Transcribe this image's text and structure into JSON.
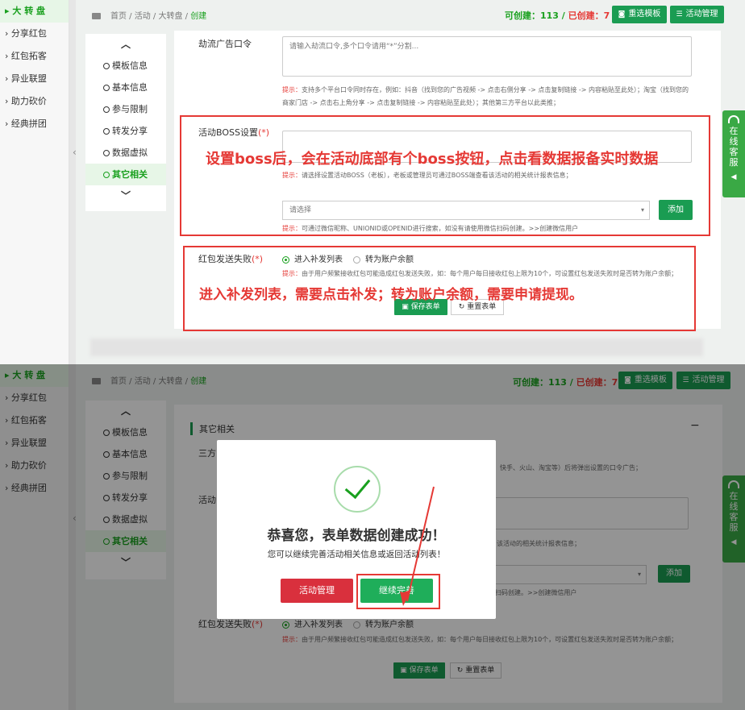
{
  "sidebar": {
    "items": [
      {
        "label": "大 转 盘"
      },
      {
        "label": "分享红包"
      },
      {
        "label": "红包拓客"
      },
      {
        "label": "异业联盟"
      },
      {
        "label": "助力砍价"
      },
      {
        "label": "经典拼团"
      }
    ],
    "active_index": 0
  },
  "breadcrumb": {
    "home": "首页",
    "sep": " / ",
    "activity": "活动",
    "wheel": "大转盘",
    "current": "创建"
  },
  "counts": {
    "can_create_label": "可创建：",
    "can_create": "113",
    "divider": " / ",
    "created_label": "已创建：",
    "created": "7"
  },
  "toolbar": {
    "reselect_template": "重选模板",
    "activity_manage": "活动管理"
  },
  "steps": [
    {
      "label": "模板信息"
    },
    {
      "label": "基本信息"
    },
    {
      "label": "参与限制"
    },
    {
      "label": "转发分享"
    },
    {
      "label": "数据虚拟"
    },
    {
      "label": "其它相关"
    }
  ],
  "form": {
    "ad_code_label": "劫流广告口令",
    "ad_code_placeholder": "请输入劫流口令,多个口令请用“*”分割...",
    "ad_code_hint_prefix": "提示：",
    "ad_code_hint": "支持多个平台口令同时存在，例如：抖音（找到您的广告视频 -> 点击右侧分享 -> 点击复制链接 -> 内容粘贴至此处）；淘宝（找到您的商家门店 -> 点击右上角分享 -> 点击复制链接 -> 内容粘贴至此处）；其他第三方平台以此类推；",
    "boss_label": "活动BOSS设置",
    "required_mark": "(*)",
    "boss_hint_prefix": "提示：",
    "boss_hint": "请选择设置活动BOSS（老板），老板或管理员可通过BOSS端查看该活动的相关统计报表信息；",
    "boss_select_placeholder": "请选择",
    "add_button": "添加",
    "search_hint_prefix": "提示：",
    "search_hint": "可通过微信昵称、UNIONID或OPENID进行搜索，如没有请使用微信扫码创建。>>创建微信用户",
    "fail_label": "红包发送失败",
    "radio_reissue": "进入补发列表",
    "radio_balance": "转为账户余额",
    "fail_hint_prefix": "提示：",
    "fail_hint": "由于用户频繁接收红包可能造成红包发送失败，如：每个用户每日接收红包上限为10个，可设置红包发送失败时是否转为账户余额；",
    "save_button": "保存表单",
    "reset_button": "重置表单"
  },
  "annotations": {
    "boss": "设置boss后，会在活动底部有个boss按钮，点击看数据报备实时数据",
    "fail": "进入补发列表，需要点击补发；转为账户余额，需要申请提现。"
  },
  "customer_service": {
    "label": "在线客服"
  },
  "panel2": {
    "section_title": "其它相关",
    "third_party_label": "三方",
    "third_party_hint_tail": "快手、火山、淘宝等）后将弹出设置的口令广告；",
    "activity_label": "活动",
    "boss_hint_tail": "该活动的相关统计报表信息；",
    "search_hint_tail": "扫码创建。>>创建微信用户"
  },
  "modal": {
    "title": "恭喜您，表单数据创建成功！",
    "subtitle": "您可以继续完善活动相关信息或返回活动列表！",
    "manage_button": "活动管理",
    "continue_button": "继续完善"
  },
  "colors": {
    "primary": "#1a9c52",
    "accent_red": "#e53935",
    "modal_red": "#d9303d",
    "modal_green": "#1fae5a"
  }
}
